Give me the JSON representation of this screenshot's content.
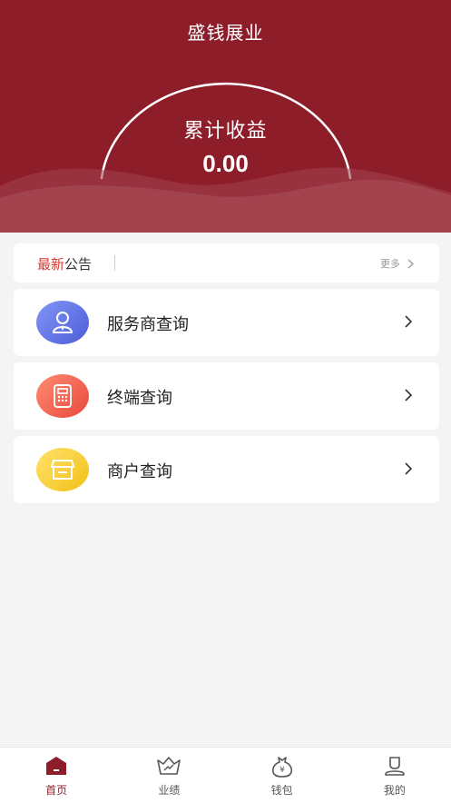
{
  "app": {
    "title": "盛钱展业"
  },
  "earnings": {
    "label": "累计收益",
    "value": "0.00"
  },
  "notice": {
    "title_highlight": "最新",
    "title_rest": "公告",
    "more_label": "更多"
  },
  "menu": [
    {
      "label": "服务商查询",
      "icon": "service-provider-icon",
      "color_from": "#7f92f7",
      "color_to": "#4f5fd8"
    },
    {
      "label": "终端查询",
      "icon": "terminal-icon",
      "color_from": "#ff8b72",
      "color_to": "#e94a3c"
    },
    {
      "label": "商户查询",
      "icon": "merchant-icon",
      "color_from": "#ffe066",
      "color_to": "#f4c21c"
    }
  ],
  "tabbar": [
    {
      "label": "首页",
      "icon": "home-icon",
      "active": true
    },
    {
      "label": "业绩",
      "icon": "performance-icon",
      "active": false
    },
    {
      "label": "钱包",
      "icon": "wallet-icon",
      "active": false
    },
    {
      "label": "我的",
      "icon": "profile-icon",
      "active": false
    }
  ],
  "colors": {
    "brand": "#8e1d2a",
    "accent_red": "#d33a32"
  }
}
